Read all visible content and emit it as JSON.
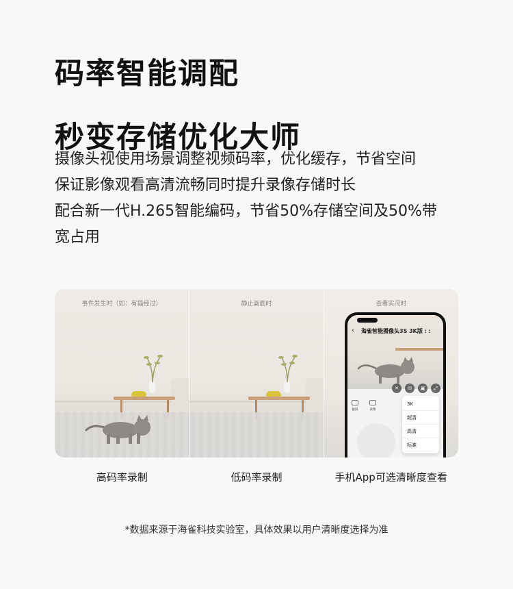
{
  "headline": {
    "line1": "码率智能调配",
    "line2": "秒变存储优化大师"
  },
  "description": [
    "摄像头视使用场景调整视频码率，优化缓存，节省空间",
    "保证影像观看高清流畅同时提升录像存储时长",
    "配合新一代H.265智能编码，节省50%存储空间及50%带",
    "宽占用"
  ],
  "panels": [
    {
      "caption": "事件发生时（如：有猫经过）",
      "label": "高码率录制"
    },
    {
      "caption": "静止画面时",
      "label": "低码率录制"
    },
    {
      "caption": "查看实况时",
      "label": "手机App可选清晰度查看"
    }
  ],
  "phone": {
    "app_title": "海雀智能摄像头3S 3K版 : :",
    "quality_options": [
      "3K",
      "超清",
      "高清",
      "标准"
    ],
    "tools": [
      "截屏",
      "录像"
    ],
    "icons": [
      "back-arrow-icon",
      "mute-icon",
      "message-icon",
      "photo-icon",
      "fullscreen-icon"
    ]
  },
  "footnote": "*数据来源于海雀科技实验室，具体效果以用户清晰度选择为准"
}
